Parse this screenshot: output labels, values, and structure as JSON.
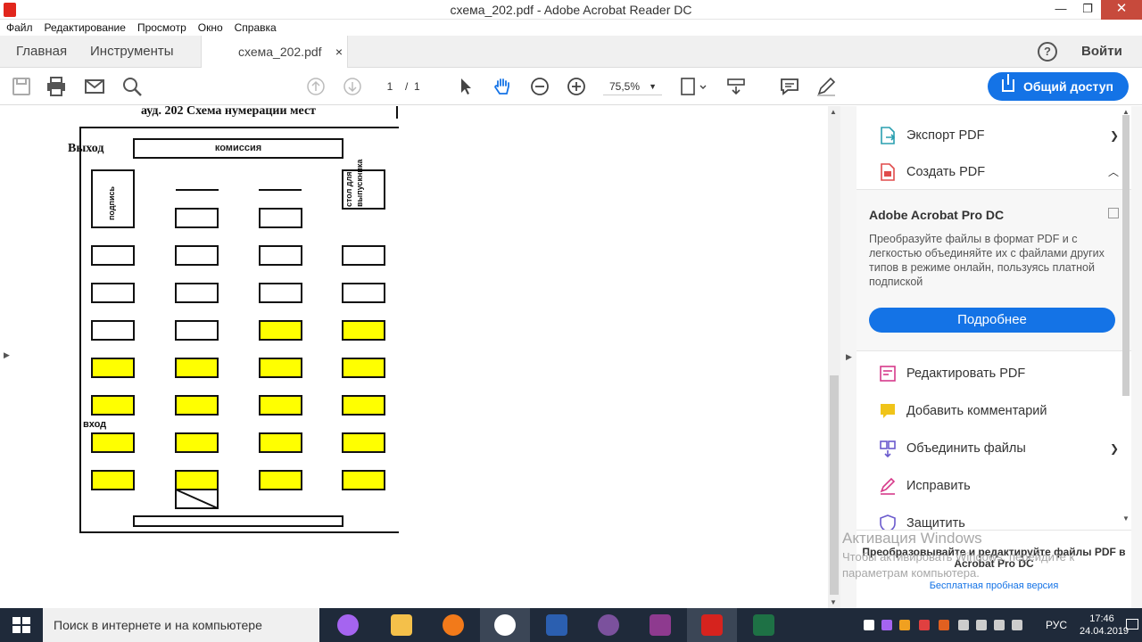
{
  "window": {
    "title": "схема_202.pdf - Adobe Acrobat Reader DC",
    "min": "—",
    "restore": "❐",
    "close": "✕"
  },
  "menu": [
    "Файл",
    "Редактирование",
    "Просмотр",
    "Окно",
    "Справка"
  ],
  "tabs": {
    "home": "Главная",
    "tools": "Инструменты",
    "doc": "схема_202.pdf",
    "close": "×"
  },
  "header": {
    "help": "?",
    "login": "Войти"
  },
  "toolbar": {
    "page_current": "1",
    "page_sep": "/",
    "page_total": "1",
    "zoom": "75,5%",
    "share": "Общий доступ"
  },
  "document": {
    "title": "ауд.   202 Схема нумерации мест",
    "exit_label": "Выход",
    "commission": "комиссия",
    "sign_label": "подпись",
    "grad_table_label": "стол для выпускника",
    "entrance_label": "вход",
    "desk_rows": [
      [
        "none",
        "white",
        "white",
        "none"
      ],
      [
        "white",
        "white",
        "white",
        "white"
      ],
      [
        "white",
        "white",
        "white",
        "white"
      ],
      [
        "white",
        "white",
        "yellow",
        "yellow"
      ],
      [
        "yellow",
        "yellow",
        "yellow",
        "yellow"
      ],
      [
        "yellow",
        "yellow",
        "yellow",
        "yellow"
      ],
      [
        "yellow",
        "yellow",
        "yellow",
        "yellow"
      ],
      [
        "yellow",
        "yellow",
        "yellow",
        "yellow"
      ]
    ]
  },
  "panel": {
    "export": "Экспорт PDF",
    "create": "Создать PDF",
    "promo_title": "Adobe Acrobat Pro DC",
    "promo_desc": "Преобразуйте файлы в формат PDF и с легкостью объединяйте их с файлами других типов в режиме онлайн, пользуясь платной подпиской",
    "promo_btn": "Подробнее",
    "edit": "Редактировать PDF",
    "comment": "Добавить комментарий",
    "combine": "Объединить файлы",
    "fill": "Исправить",
    "protect": "Защитить",
    "footer_text": "Преобразовывайте и редактируйте файлы PDF в Acrobat Pro DC",
    "footer_link": "Бесплатная пробная версия"
  },
  "watermark": {
    "line1": "Активация Windows",
    "line2": "Чтобы активировать Windows, перейдите к параметрам компьютера."
  },
  "taskbar": {
    "search": "Поиск в интернете и на компьютере",
    "lang": "РУС",
    "time": "17:46",
    "date": "24.04.2019"
  },
  "colors": {
    "accent": "#1473e6",
    "desk_yellow": "#ffff00",
    "taskbar": "#1f2a3a"
  }
}
